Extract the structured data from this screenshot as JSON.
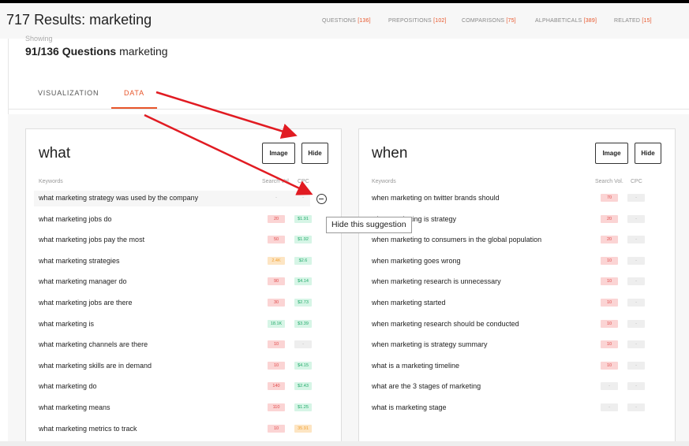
{
  "header": {
    "count": "717",
    "results_label": "Results:",
    "query": "marketing",
    "nav": [
      {
        "label": "QUESTIONS",
        "count": "[136]"
      },
      {
        "label": "PREPOSITIONS",
        "count": "[102]"
      },
      {
        "label": "COMPARISONS",
        "count": "[75]"
      },
      {
        "label": "ALPHABETICALS",
        "count": "[389]"
      },
      {
        "label": "RELATED",
        "count": "[15]"
      }
    ]
  },
  "showing": {
    "label": "Showing",
    "count": "91/136",
    "type": "Questions",
    "query": "marketing"
  },
  "tabs": [
    {
      "label": "VISUALIZATION",
      "active": false
    },
    {
      "label": "DATA",
      "active": true
    }
  ],
  "columns": {
    "keywords": "Keywords",
    "search_vol": "Search Vol.",
    "cpc": "CPC"
  },
  "buttons": {
    "image": "Image",
    "hide": "Hide"
  },
  "tooltip": "Hide this suggestion",
  "panels": [
    {
      "heading": "what",
      "rows": [
        {
          "keyword": "what marketing strategy was used by the company",
          "vol": "-",
          "cpc": "-",
          "vol_color": "none",
          "cpc_color": "none",
          "highlighted": true
        },
        {
          "keyword": "what marketing jobs do",
          "vol": "20",
          "cpc": "$1.91",
          "vol_color": "red",
          "cpc_color": "green"
        },
        {
          "keyword": "what marketing jobs pay the most",
          "vol": "50",
          "cpc": "$1.92",
          "vol_color": "red",
          "cpc_color": "green"
        },
        {
          "keyword": "what marketing strategies",
          "vol": "2.4K",
          "cpc": "$2.6",
          "vol_color": "orange",
          "cpc_color": "green"
        },
        {
          "keyword": "what marketing manager do",
          "vol": "90",
          "cpc": "$4.14",
          "vol_color": "red",
          "cpc_color": "green"
        },
        {
          "keyword": "what marketing jobs are there",
          "vol": "30",
          "cpc": "$2.73",
          "vol_color": "red",
          "cpc_color": "green"
        },
        {
          "keyword": "what marketing is",
          "vol": "18.1K",
          "cpc": "$3.39",
          "vol_color": "green",
          "cpc_color": "green"
        },
        {
          "keyword": "what marketing channels are there",
          "vol": "10",
          "cpc": "-",
          "vol_color": "red",
          "cpc_color": "grey"
        },
        {
          "keyword": "what marketing skills are in demand",
          "vol": "10",
          "cpc": "$4.15",
          "vol_color": "red",
          "cpc_color": "green"
        },
        {
          "keyword": "what marketing do",
          "vol": "140",
          "cpc": "$2.43",
          "vol_color": "red",
          "cpc_color": "green"
        },
        {
          "keyword": "what marketing means",
          "vol": "110",
          "cpc": "$1.25",
          "vol_color": "red",
          "cpc_color": "green"
        },
        {
          "keyword": "what marketing metrics to track",
          "vol": "10",
          "cpc": "35.91",
          "vol_color": "red",
          "cpc_color": "orange"
        }
      ]
    },
    {
      "heading": "when",
      "rows": [
        {
          "keyword": "when marketing on twitter brands should",
          "vol": "70",
          "cpc": "-",
          "vol_color": "red",
          "cpc_color": "grey"
        },
        {
          "keyword": "when marketing is strategy",
          "vol": "20",
          "cpc": "-",
          "vol_color": "red",
          "cpc_color": "grey"
        },
        {
          "keyword": "when marketing to consumers in the global population",
          "vol": "20",
          "cpc": "-",
          "vol_color": "red",
          "cpc_color": "grey"
        },
        {
          "keyword": "when marketing goes wrong",
          "vol": "10",
          "cpc": "-",
          "vol_color": "red",
          "cpc_color": "grey"
        },
        {
          "keyword": "when marketing research is unnecessary",
          "vol": "10",
          "cpc": "-",
          "vol_color": "red",
          "cpc_color": "grey"
        },
        {
          "keyword": "when marketing started",
          "vol": "10",
          "cpc": "-",
          "vol_color": "red",
          "cpc_color": "grey"
        },
        {
          "keyword": "when marketing research should be conducted",
          "vol": "10",
          "cpc": "-",
          "vol_color": "red",
          "cpc_color": "grey"
        },
        {
          "keyword": "when marketing is strategy summary",
          "vol": "10",
          "cpc": "-",
          "vol_color": "red",
          "cpc_color": "grey"
        },
        {
          "keyword": "what is a marketing timeline",
          "vol": "10",
          "cpc": "-",
          "vol_color": "red",
          "cpc_color": "grey"
        },
        {
          "keyword": "what are the 3 stages of marketing",
          "vol": "-",
          "cpc": "-",
          "vol_color": "grey",
          "cpc_color": "grey"
        },
        {
          "keyword": "what is marketing stage",
          "vol": "-",
          "cpc": "-",
          "vol_color": "grey",
          "cpc_color": "grey"
        }
      ]
    }
  ],
  "colors": {
    "accent": "#e8562b",
    "annotation_arrow": "#e11b22"
  }
}
